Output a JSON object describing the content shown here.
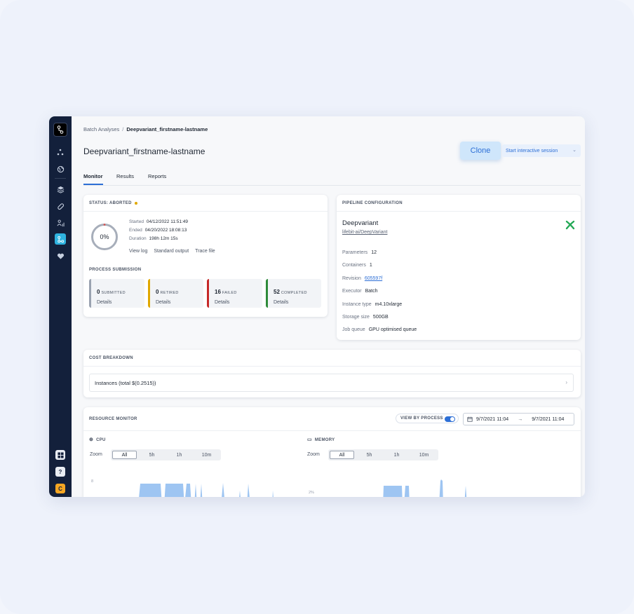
{
  "breadcrumb": {
    "parent": "Batch Analyses",
    "separator": "/",
    "current": "Deepvariant_firstname-lastname"
  },
  "page": {
    "title": "Deepvariant_firstname-lastname"
  },
  "actions": {
    "clone_label": "Clone",
    "session_label": "Start interactive session"
  },
  "tabs": [
    {
      "label": "Monitor",
      "active": true
    },
    {
      "label": "Results",
      "active": false
    },
    {
      "label": "Reports",
      "active": false
    }
  ],
  "status": {
    "header": "STATUS: ABORTED",
    "progress_text": "0%",
    "progress": 0,
    "started_label": "Started",
    "started_value": "04/12/2022 11:51:49",
    "ended_label": "Ended",
    "ended_value": "04/20/2022 18:08:13",
    "duration_label": "Duration",
    "duration_value": "198h 12m 15s",
    "links": [
      "View log",
      "Standard output",
      "Trace file"
    ],
    "submission_title": "PROCESS SUBMISSION",
    "submissions": [
      {
        "count": "0",
        "label": "SUBMITTED",
        "details": "Details",
        "color": "#9aa2b0"
      },
      {
        "count": "0",
        "label": "RETIRED",
        "details": "Details",
        "color": "#e0a800"
      },
      {
        "count": "16",
        "label": "FAILED",
        "details": "Details",
        "color": "#c62828"
      },
      {
        "count": "52",
        "label": "COMPLETED",
        "details": "Details",
        "color": "#2e8b3a"
      }
    ]
  },
  "pipeline": {
    "header": "PIPELINE CONFIGURATION",
    "name": "Deepvariant",
    "repo": "lifebit-ai/DeepVariant",
    "rows": [
      {
        "key": "Parameters",
        "value": "12",
        "link": false
      },
      {
        "key": "Containers",
        "value": "1",
        "link": false
      },
      {
        "key": "Revision",
        "value": "605597f",
        "link": true
      },
      {
        "key": "Executor",
        "value": "Batch",
        "link": false
      },
      {
        "key": "Instance type",
        "value": "m4.10xlarge",
        "link": false
      },
      {
        "key": "Storage size",
        "value": "500GB",
        "link": false
      },
      {
        "key": "Job queue",
        "value": "GPU optimised queue",
        "link": false
      }
    ]
  },
  "cost": {
    "header": "COST BREAKDOWN",
    "row": "Instances (total $(0.2515))"
  },
  "resource": {
    "header": "RESOURCE MONITOR",
    "view_by_process": "VIEW BY PROCESS",
    "date_from": "9/7/2021 11:04",
    "date_to": "9/7/2021 11:04",
    "cpu_label": "CPU",
    "memory_label": "MEMORY",
    "zoom_label": "Zoom",
    "zoom_options": [
      "All",
      "5h",
      "1h",
      "10m"
    ],
    "cpu_axis_tick": "8",
    "memory_axis_tick": "2%"
  },
  "sidebar": {
    "icons": [
      "logo-icon",
      "nodes-icon",
      "globe-icon",
      "layers-icon",
      "pill-icon",
      "user-chart-icon",
      "workflow-icon",
      "heart-icon"
    ],
    "help": "?",
    "user_initial": "C"
  },
  "colors": {
    "accent": "#2d6fd6",
    "sidebar": "#13203b",
    "active_icon": "#2fb3e0",
    "chart_fill": "#9ec5f2"
  }
}
